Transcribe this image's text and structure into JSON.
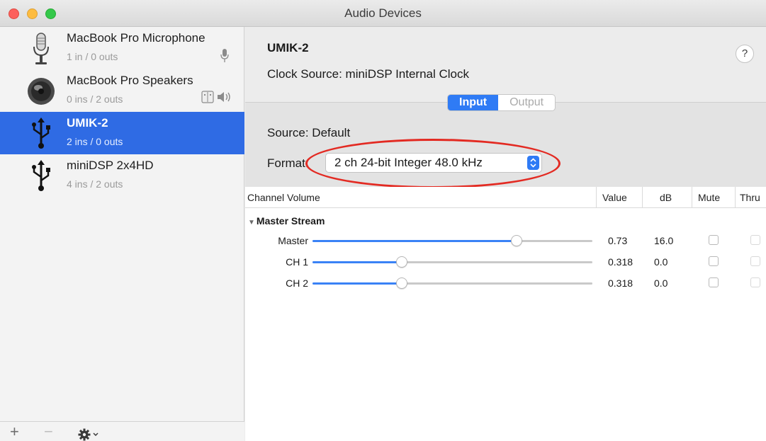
{
  "window": {
    "title": "Audio Devices"
  },
  "sidebar": {
    "devices": [
      {
        "name": "MacBook Pro Microphone",
        "io": "1 in / 0 outs",
        "icon": "microphone-icon",
        "selected": false
      },
      {
        "name": "MacBook Pro Speakers",
        "io": "0 ins / 2 outs",
        "icon": "speaker-icon",
        "selected": false
      },
      {
        "name": "UMIK-2",
        "io": "2 ins / 0 outs",
        "icon": "usb-icon",
        "selected": true
      },
      {
        "name": "miniDSP 2x4HD",
        "io": "4 ins / 2 outs",
        "icon": "usb-icon",
        "selected": false
      }
    ],
    "footer": {
      "add": "+",
      "remove": "−"
    }
  },
  "detail": {
    "device_name": "UMIK-2",
    "clock_source": "Clock Source:  miniDSP Internal Clock",
    "help": "?",
    "tabs": [
      {
        "label": "Input",
        "active": true
      },
      {
        "label": "Output",
        "active": false
      }
    ],
    "source": "Source:  Default",
    "format_label": "Format:",
    "format_value": "2 ch 24-bit Integer 48.0 kHz",
    "table": {
      "headers": [
        "Channel Volume",
        "Value",
        "dB",
        "Mute",
        "Thru"
      ],
      "group": "Master Stream",
      "rows": [
        {
          "label": "Master",
          "level": 0.73,
          "value": "0.73",
          "db": "16.0"
        },
        {
          "label": "CH 1",
          "level": 0.318,
          "value": "0.318",
          "db": "0.0"
        },
        {
          "label": "CH 2",
          "level": 0.318,
          "value": "0.318",
          "db": "0.0"
        }
      ]
    }
  },
  "colors": {
    "selection": "#2f6be4",
    "accent": "#2f7bf5",
    "annotation": "#e32a22"
  }
}
